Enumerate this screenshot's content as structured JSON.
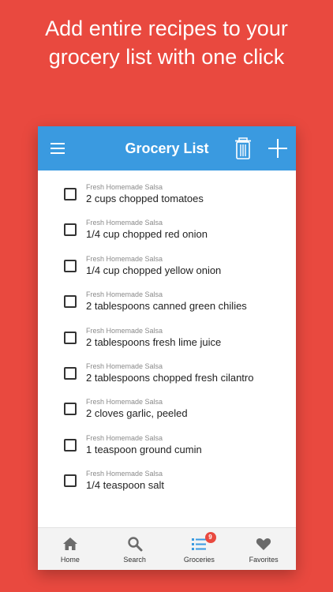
{
  "headline": "Add entire recipes to your grocery list with one click",
  "app": {
    "title": "Grocery List"
  },
  "items": [
    {
      "source": "Fresh Homemade Salsa",
      "text": "2 cups chopped tomatoes",
      "checked": false
    },
    {
      "source": "Fresh Homemade Salsa",
      "text": "1/4 cup chopped red onion",
      "checked": false
    },
    {
      "source": "Fresh Homemade Salsa",
      "text": "1/4 cup chopped yellow onion",
      "checked": false
    },
    {
      "source": "Fresh Homemade Salsa",
      "text": "2 tablespoons canned green chilies",
      "checked": false
    },
    {
      "source": "Fresh Homemade Salsa",
      "text": "2 tablespoons fresh lime juice",
      "checked": false
    },
    {
      "source": "Fresh Homemade Salsa",
      "text": "2 tablespoons chopped fresh cilantro",
      "checked": false
    },
    {
      "source": "Fresh Homemade Salsa",
      "text": "2 cloves garlic, peeled",
      "checked": false
    },
    {
      "source": "Fresh Homemade Salsa",
      "text": "1 teaspoon ground cumin",
      "checked": false
    },
    {
      "source": "Fresh Homemade Salsa",
      "text": "1/4 teaspoon salt",
      "checked": false
    }
  ],
  "tabs": [
    {
      "label": "Home",
      "icon": "home-icon"
    },
    {
      "label": "Search",
      "icon": "search-icon"
    },
    {
      "label": "Groceries",
      "icon": "list-icon",
      "badge": "9",
      "active": true
    },
    {
      "label": "Favorites",
      "icon": "heart-icon"
    }
  ],
  "colors": {
    "background": "#e9493f",
    "app_bar": "#3a9ae0",
    "active_tab": "#3a9ae0",
    "inactive_tab": "#6b6b6b",
    "badge": "#e9493f"
  }
}
